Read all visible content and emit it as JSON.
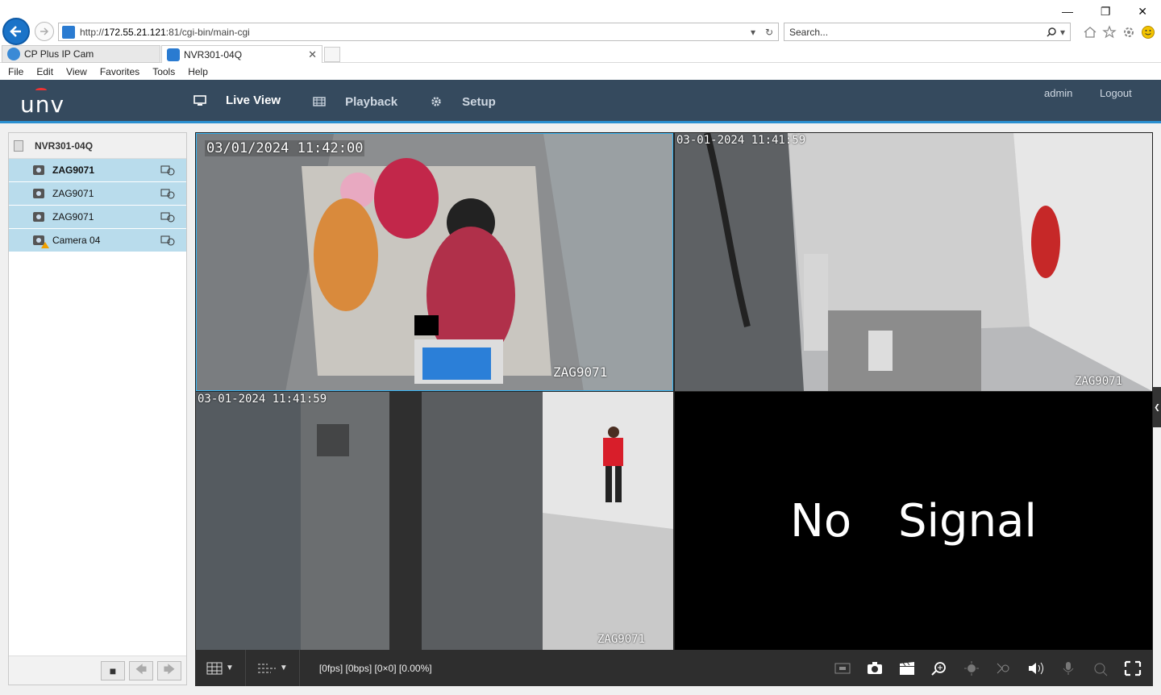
{
  "browser": {
    "url_prefix": "http://",
    "url_host": "172.55.21.121",
    "url_rest": ":81/cgi-bin/main-cgi",
    "search_placeholder": "Search...",
    "tabs": [
      {
        "label": "CP Plus IP Cam"
      },
      {
        "label": "NVR301-04Q"
      }
    ],
    "menu": [
      "File",
      "Edit",
      "View",
      "Favorites",
      "Tools",
      "Help"
    ]
  },
  "app": {
    "logo": "unv",
    "nav": [
      {
        "label": "Live View",
        "icon": "monitor-icon",
        "active": true
      },
      {
        "label": "Playback",
        "icon": "film-icon",
        "active": false
      },
      {
        "label": "Setup",
        "icon": "gear-icon",
        "active": false
      }
    ],
    "user": "admin",
    "logout": "Logout"
  },
  "device_tree": {
    "nvr": "NVR301-04Q",
    "cameras": [
      {
        "name": "ZAG9071",
        "bold": true,
        "warning": false
      },
      {
        "name": "ZAG9071",
        "bold": false,
        "warning": false
      },
      {
        "name": "ZAG9071",
        "bold": false,
        "warning": false
      },
      {
        "name": "Camera 04",
        "bold": false,
        "warning": true
      }
    ]
  },
  "tiles": [
    {
      "timestamp": "03/01/2024 11:42:00",
      "camera_label": "ZAG9071"
    },
    {
      "timestamp": "03-01-2024 11:41:59",
      "camera_label": "ZAG9071"
    },
    {
      "timestamp": "03-01-2024 11:41:59",
      "camera_label": "ZAG9071"
    },
    {
      "no_signal": "No Signal"
    }
  ],
  "toolbar": {
    "stream_stats": "[0fps] [0bps] [0×0] [0.00%]"
  },
  "colors": {
    "header_bg": "#354a5e",
    "accent": "#36b3f1",
    "tree_selected": "#b9dcec"
  }
}
